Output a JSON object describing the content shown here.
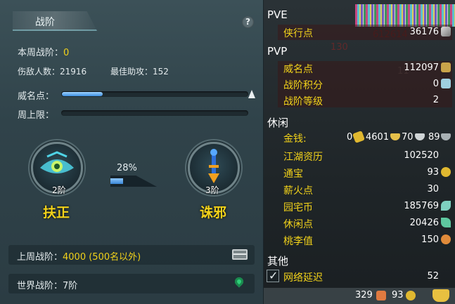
{
  "left": {
    "title": "战阶",
    "help": "?",
    "weekly_rank_label": "本周战阶：",
    "weekly_rank_value": "0",
    "injured_label": "伤敌人数：",
    "injured_value": "21916",
    "best_assist_label": "最佳助攻：",
    "best_assist_value": "152",
    "prestige_label": "威名点：",
    "prestige_progress": 0.22,
    "weekly_cap_label": "周上限：",
    "weekly_cap_progress": 0,
    "left_emblem": {
      "level": "2阶",
      "name": "扶正"
    },
    "ratio_percent": "28%",
    "ratio_fill": 0.28,
    "right_emblem": {
      "level": "3阶",
      "name": "诛邪"
    },
    "last_week_label": "上周战阶：",
    "last_week_value": "4000 (500名以外)",
    "world_rank_label": "世界战阶：",
    "world_rank_value": "7阶"
  },
  "right": {
    "pve_title": "PVE",
    "pve_rows": [
      {
        "label": "侠行点",
        "value": "36176",
        "icon": "sword-icon"
      }
    ],
    "pvp_title": "PVP",
    "pvp_rows": [
      {
        "label": "威名点",
        "value": "112097",
        "icon": "mask-icon"
      },
      {
        "label": "战阶积分",
        "value": "0",
        "icon": "badge-icon"
      },
      {
        "label": "战阶等级",
        "value": "2",
        "icon": ""
      }
    ],
    "leisure_title": "休闲",
    "money": {
      "label": "金钱:",
      "gold": "0",
      "yuanbao": "4601",
      "silver": "70",
      "copper": "89"
    },
    "leisure_rows": [
      {
        "label": "江湖资历",
        "value": "102520",
        "icon": ""
      },
      {
        "label": "通宝",
        "value": "93",
        "icon": "coin-icon"
      },
      {
        "label": "薪火点",
        "value": "30",
        "icon": ""
      },
      {
        "label": "园宅币",
        "value": "185769",
        "icon": "leaf-icon"
      },
      {
        "label": "休闲点",
        "value": "20426",
        "icon": "feather-icon"
      },
      {
        "label": "桃李值",
        "value": "150",
        "icon": "gourd-icon"
      }
    ],
    "other_title": "其他",
    "latency_label": "网络延迟",
    "latency_value": "52",
    "bottom": {
      "value1": "329",
      "value2": "93"
    },
    "overlay_numbers": [
      "612614",
      "130",
      "11"
    ]
  },
  "colors": {
    "gold": "#f2d21a",
    "bar_blue": "#3d8ee0",
    "panel_teal": "#30434a"
  }
}
